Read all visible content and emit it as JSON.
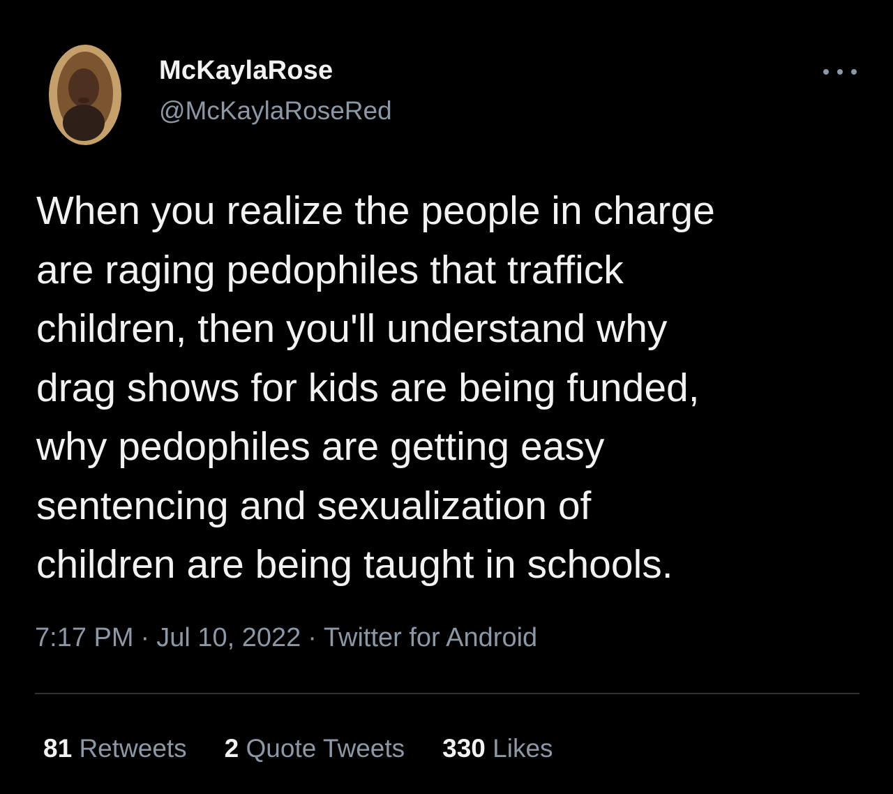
{
  "user": {
    "display_name": "McKaylaRose",
    "handle": "@McKaylaRoseRed"
  },
  "icons": {
    "more": "more-icon"
  },
  "tweet": {
    "text": "When you realize the people in charge\nare raging pedophiles that traffick\nchildren, then you'll understand why\ndrag shows for kids are being funded,\nwhy pedophiles are getting easy\nsentencing and sexualization of\nchildren are being taught in schools."
  },
  "meta": {
    "time": "7:17 PM",
    "date": "Jul 10, 2022",
    "source": "Twitter for Android",
    "separator": "·"
  },
  "stats": {
    "retweets_count": "81",
    "retweets_label": "Retweets",
    "quotes_count": "2",
    "quotes_label": "Quote Tweets",
    "likes_count": "330",
    "likes_label": "Likes"
  },
  "colors": {
    "background": "#000000",
    "primary_text": "#f2f2f2",
    "secondary_text": "#8b98a5",
    "divider": "#2f3336"
  }
}
